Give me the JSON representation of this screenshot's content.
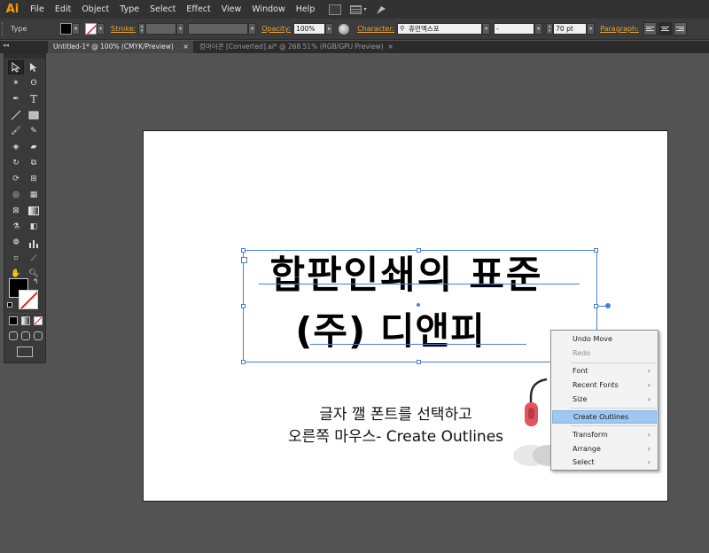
{
  "app": {
    "logo": "Ai"
  },
  "menu": [
    "File",
    "Edit",
    "Object",
    "Type",
    "Select",
    "Effect",
    "View",
    "Window",
    "Help"
  ],
  "control_bar": {
    "selection_label": "Type",
    "stroke_label": "Stroke:",
    "opacity_label": "Opacity:",
    "opacity_value": "100%",
    "character_label": "Character:",
    "font_value": "휴먼엑스포",
    "style_value": "-",
    "size_value": "70 pt",
    "paragraph_label": "Paragraph:"
  },
  "tabs": [
    {
      "label": "Untitled-1* @ 100% (CMYK/Preview)",
      "close": "×"
    },
    {
      "label": "컴마이콘 [Converted].ai* @ 268.51% (RGB/GPU Preview)",
      "close": "×"
    }
  ],
  "artwork": {
    "headline_line1": "합판인쇄의 표준",
    "headline_line2": "(주) 디앤피",
    "caption_line1": "글자 깰 폰트를 선택하고",
    "caption_line2": "오른쪽 마우스- Create Outlines"
  },
  "context_menu": {
    "undo": "Undo Move",
    "redo": "Redo",
    "font": "Font",
    "recent_fonts": "Recent Fonts",
    "size": "Size",
    "create_outlines": "Create Outlines",
    "transform": "Transform",
    "arrange": "Arrange",
    "select": "Select",
    "submenu_arrow": "›"
  },
  "colors": {
    "accent": "#4a7fd8",
    "highlight": "#9fc8f0",
    "mouse_accent": "#e0555e"
  }
}
